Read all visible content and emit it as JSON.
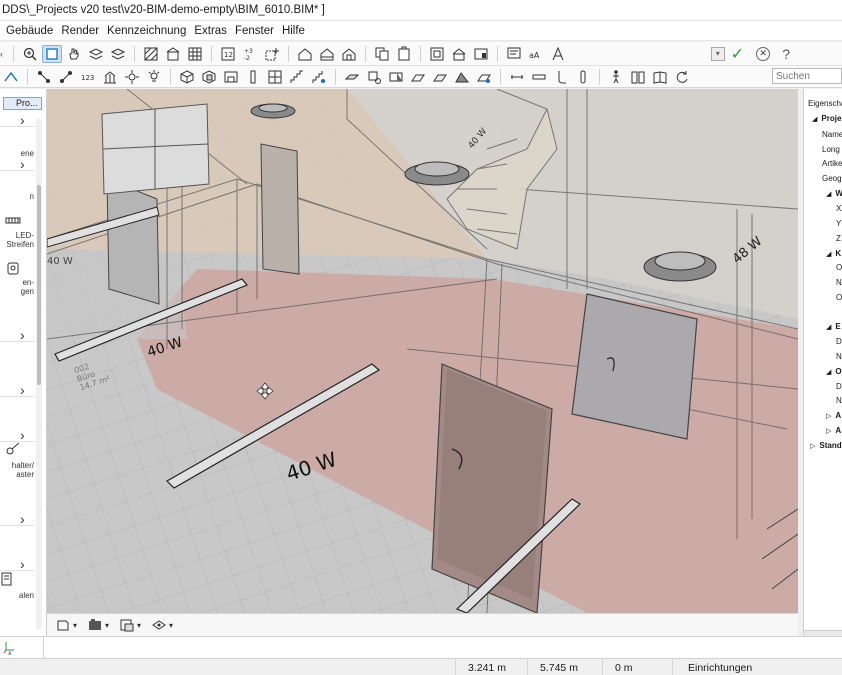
{
  "window": {
    "title": "DDS\\_Projects v20 test\\v20-BIM-demo-empty\\BIM_6010.BIM* ]"
  },
  "menu": [
    "Gebäude",
    "Render",
    "Kennzeichnung",
    "Extras",
    "Fenster",
    "Hilfe"
  ],
  "toolbar": {
    "search_placeholder": "Suchen"
  },
  "left_panel": {
    "tab_label": "Pro...",
    "labels": [
      "ene",
      "n",
      "LED-",
      "Streifen",
      "en-",
      "gen",
      "halter/",
      "aster",
      "alen"
    ]
  },
  "viewport": {
    "power_labels": [
      "40 W",
      "40 W",
      "48 W",
      "40 W",
      "40 W"
    ],
    "room_label": [
      "002",
      "Büro",
      "14.7 m²"
    ]
  },
  "right_panel": {
    "title": "Eigenschaften",
    "items": [
      "Projekt",
      "Name",
      "Long n",
      "Artikel",
      "Geogr",
      "W",
      "X",
      "Y",
      "Z",
      "K",
      "O",
      "N",
      "O",
      "E",
      "D",
      "N",
      "O",
      "D",
      "N",
      "A",
      "A",
      "Standa"
    ]
  },
  "status": {
    "x": "3.241 m",
    "y": "5.745 m",
    "z": "0 m",
    "mode": "Einrichtungen"
  },
  "colors": {
    "accent": "#0078d7",
    "ok": "#2f9a2f",
    "floor_red": "#c9a8a4",
    "wall_tan": "#d8c8b4"
  }
}
